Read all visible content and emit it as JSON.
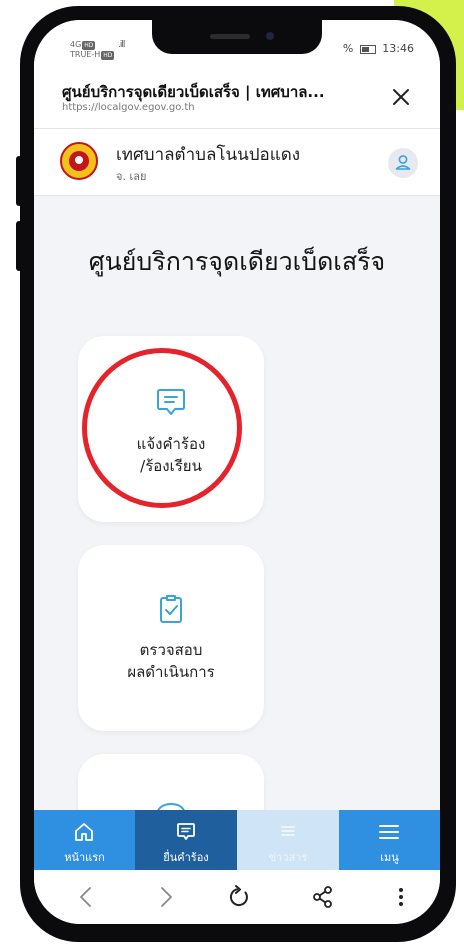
{
  "status_bar": {
    "carrier_lines": [
      "4G",
      "TRUE-H"
    ],
    "signal": ".ill",
    "battery_percent": "%",
    "time": "13:46"
  },
  "browser": {
    "title": "ศูนย์บริการจุดเดียวเบ็ดเสร็จ | เทศบาล...",
    "url": "https://localgov.egov.go.th",
    "close_icon": "close-icon"
  },
  "org": {
    "name": "เทศบาลตำบลโนนปอแดง",
    "province": "จ. เลย",
    "logo_icon": "municipal-seal-icon",
    "user_icon": "user-icon"
  },
  "page": {
    "title": "ศูนย์บริการจุดเดียวเบ็ดเสร็จ"
  },
  "cards": [
    {
      "line1": "แจ้งคำร้อง",
      "line2": "/ร้องเรียน",
      "icon": "message-icon",
      "highlighted": true
    },
    {
      "line1": "ตรวจสอบ",
      "line2": "ผลดำเนินการ",
      "icon": "clipboard-check-icon"
    },
    {
      "line1": "",
      "line2": "",
      "icon": "chat-bubble-icon"
    }
  ],
  "bottom_nav": [
    {
      "label": "หน้าแรก",
      "icon": "home-icon"
    },
    {
      "label": "ยื่นคำร้อง",
      "icon": "message-icon",
      "state": "active"
    },
    {
      "label": "ข่าวสาร",
      "icon": "news-icon",
      "state": "disabled"
    },
    {
      "label": "เมนู",
      "icon": "menu-icon"
    }
  ],
  "browser_nav": {
    "icons": [
      "back-icon",
      "forward-icon",
      "reload-icon",
      "share-icon",
      "more-icon"
    ]
  },
  "colors": {
    "nav_blue": "#2f8fe0",
    "nav_active": "#1f5f9e",
    "icon_teal": "#3aa3d9",
    "highlight_red": "#e5232a",
    "accent_lime": "#d4f04a"
  }
}
